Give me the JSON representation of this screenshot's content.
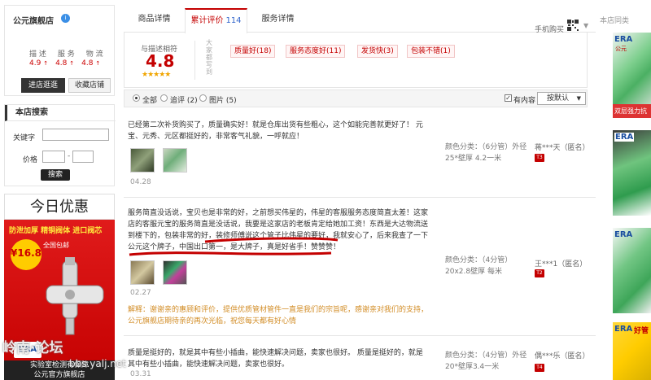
{
  "shop": {
    "name": "公元旗舰店",
    "badge": "i",
    "rating_labels": [
      "描 述",
      "服 务",
      "物 流"
    ],
    "ratings": [
      {
        "value": "4.9",
        "arrow": "↑"
      },
      {
        "value": "4.8",
        "arrow": "↑"
      },
      {
        "value": "4.8",
        "arrow": "↑"
      }
    ],
    "enter_btn": "进店逛逛",
    "fav_btn": "收藏店铺"
  },
  "search": {
    "title": "本店搜索",
    "keyword_label": "关键字",
    "price_label": "价格",
    "dash": "-",
    "button": "搜索"
  },
  "promo": {
    "title": "今日优惠",
    "line1": "防泄加厚 精铜阀体 进口阀芯",
    "price": "¥16.8",
    "tag": "全国包邮",
    "brand": "ERA",
    "bottom1": "实验室检测有保障",
    "bottom2": "公元官方旗舰店"
  },
  "tabs": [
    {
      "label": "商品详情",
      "count": ""
    },
    {
      "label": "累计评价",
      "count": "114"
    },
    {
      "label": "服务详情",
      "count": ""
    }
  ],
  "mobile_buy": "手机购买",
  "summary": {
    "desc_label": "与描述相符",
    "score": "4.8",
    "stars": "★★★★★",
    "vertical_label": "大家都写到",
    "tags": [
      "质量好(18)",
      "服务态度好(11)",
      "发货快(3)",
      "包装不错(1)"
    ]
  },
  "filter": {
    "options": [
      {
        "label": "全部",
        "checked": true
      },
      {
        "label": "追评 (2)",
        "checked": false
      },
      {
        "label": "图片 (5)",
        "checked": false
      }
    ],
    "has_content": "有内容",
    "sort": "按默认"
  },
  "reviews": [
    {
      "text": "已经第二次补货购买了，质量确实好！就是仓库出货有些粗心，这个如能完善就更好了！ 元宝、元秀、元区都挺好的，非常客气礼貌，一呼就应！",
      "date": "04.28",
      "spec_label": "颜色分类：（6分管）外径25*壁厚 4.2一米",
      "user": "蒋***天（匿名）",
      "level": "T3",
      "explain": ""
    },
    {
      "text": "服务简直没话说，宝贝也是非常的好，之前想买伟星的，伟星的客服服务态度简直太差！这家店的客服元宝的服务简直是没话说，我要是这家店的老板肯定给她加工资！东西是大达物流送到楼下的，包装非常的好，装修师傅说这个管子比伟星的要好，我就安心了，后来我查了一下公元这个牌子，中国出口第一，是大牌子，真是好省手！赞赞赞！",
      "date": "02.27",
      "spec_label": "颜色分类：（4分管）20x2.8壁厚 每米",
      "user": "王***1（匿名）",
      "level": "T2",
      "explain": "解释：谢谢亲的惠顾和评价，提供优质管材管件一直是我们的宗旨呢，感谢亲对我们的支持，公元旗舰店期待亲的再次光临，祝您每天都有好心情"
    },
    {
      "text": "质量是挺好的，就是其中有些小插曲，能快速解决问题，卖家也很好。 质量是挺好的，就是其中有些小插曲，能快速解决问题，卖家也很好。",
      "date": "03.31",
      "spec_label": "颜色分类：（4分管）外径20*壁厚3.4一米",
      "user": "偶***乐（匿名）",
      "level": "T4",
      "explain": ""
    }
  ],
  "watermark": {
    "line1": "岭南·论坛",
    "line2": "bbs.yalj.net"
  },
  "right": {
    "head": "本店同类",
    "products": [
      {
        "brand": "ERA",
        "label": "公元"
      },
      {
        "brand": "",
        "label": "双层强力抗"
      },
      {
        "brand": "ERA",
        "label": "公元"
      },
      {
        "brand": "ERA",
        "label": "公元"
      },
      {
        "brand": "ERA",
        "label": "好管"
      }
    ]
  },
  "colors": {
    "accent": "#c40000",
    "link": "#3366cc",
    "star": "#f0a500",
    "explain": "#d28c25"
  }
}
